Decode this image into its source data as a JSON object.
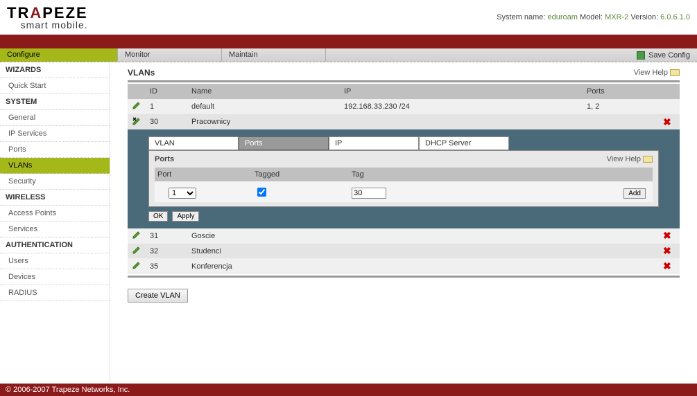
{
  "header": {
    "logo_main_pre": "TR",
    "logo_main_a": "A",
    "logo_main_post": "PEZE",
    "logo_sub": "smart mobile.",
    "sys_label": "System name: ",
    "sys_name": "eduroam",
    "model_label": "  Model: ",
    "model": "MXR-2",
    "ver_label": "  Version: ",
    "version": "6.0.6.1.0"
  },
  "tabs": {
    "configure": "Configure",
    "monitor": "Monitor",
    "maintain": "Maintain",
    "save": "Save Config"
  },
  "sidebar": {
    "wizards": "WIZARDS",
    "quickstart": "Quick Start",
    "system": "SYSTEM",
    "general": "General",
    "ipservices": "IP Services",
    "ports": "Ports",
    "vlans": "VLANs",
    "security": "Security",
    "wireless": "WIRELESS",
    "aps": "Access Points",
    "services": "Services",
    "auth": "AUTHENTICATION",
    "users": "Users",
    "devices": "Devices",
    "radius": "RADIUS"
  },
  "page": {
    "title": "VLANs",
    "viewhelp": "View Help "
  },
  "columns": {
    "id": "ID",
    "name": "Name",
    "ip": "IP",
    "ports": "Ports"
  },
  "rows": {
    "r1": {
      "id": "1",
      "name": "default",
      "ip": "192.168.33.230 /24",
      "ports": "1, 2"
    },
    "r2": {
      "id": "30",
      "name": "Pracownicy",
      "ip": "",
      "ports": ""
    },
    "r3": {
      "id": "31",
      "name": "Goscie",
      "ip": "",
      "ports": ""
    },
    "r4": {
      "id": "32",
      "name": "Studenci",
      "ip": "",
      "ports": ""
    },
    "r5": {
      "id": "35",
      "name": "Konferencja",
      "ip": "",
      "ports": ""
    }
  },
  "subtabs": {
    "vlan": "VLAN",
    "ports": "Ports",
    "ip": "IP",
    "dhcp": "DHCP Server"
  },
  "subpanel": {
    "title": "Ports",
    "col_port": "Port",
    "col_tagged": "Tagged",
    "col_tag": "Tag",
    "port_value": "1",
    "tag_value": "30",
    "tagged_checked": true,
    "add": "Add",
    "ok": "OK",
    "apply": "Apply"
  },
  "create": "Create VLAN",
  "footer": "© 2006-2007 Trapeze Networks, Inc."
}
